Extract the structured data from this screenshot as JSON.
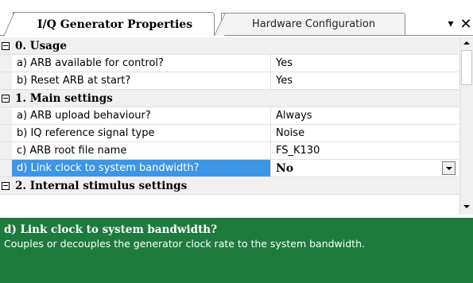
{
  "tabs": {
    "active_label": "I/Q Generator Properties",
    "inactive_label": "Hardware Configuration",
    "menu_glyph": "▾",
    "close_glyph": "✕"
  },
  "grid": {
    "categories": [
      {
        "label": "0. Usage",
        "properties": [
          {
            "name": "a) ARB available for control?",
            "value": "Yes"
          },
          {
            "name": "b) Reset ARB at start?",
            "value": "Yes"
          }
        ]
      },
      {
        "label": "1. Main settings",
        "properties": [
          {
            "name": "a) ARB upload behaviour?",
            "value": "Always"
          },
          {
            "name": "b) IQ reference signal type",
            "value": "Noise"
          },
          {
            "name": "c) ARB root file name",
            "value": "FS_K130"
          },
          {
            "name": "d) Link clock to system bandwidth?",
            "value": "No",
            "selected": true
          }
        ]
      },
      {
        "label": "2. Internal stimulus settings",
        "properties": []
      }
    ]
  },
  "description": {
    "title": "d) Link clock to system bandwidth?",
    "text": "Couples or decouples the generator clock rate to the system bandwidth."
  },
  "colors": {
    "selection": "#3d95e6",
    "description_bg": "#1e7a3d"
  },
  "icons": {
    "expander": "collapse-minus-icon",
    "dropdown": "chevron-down-icon",
    "scroll_up": "scroll-up-arrow-icon",
    "scroll_down": "scroll-down-arrow-icon"
  }
}
